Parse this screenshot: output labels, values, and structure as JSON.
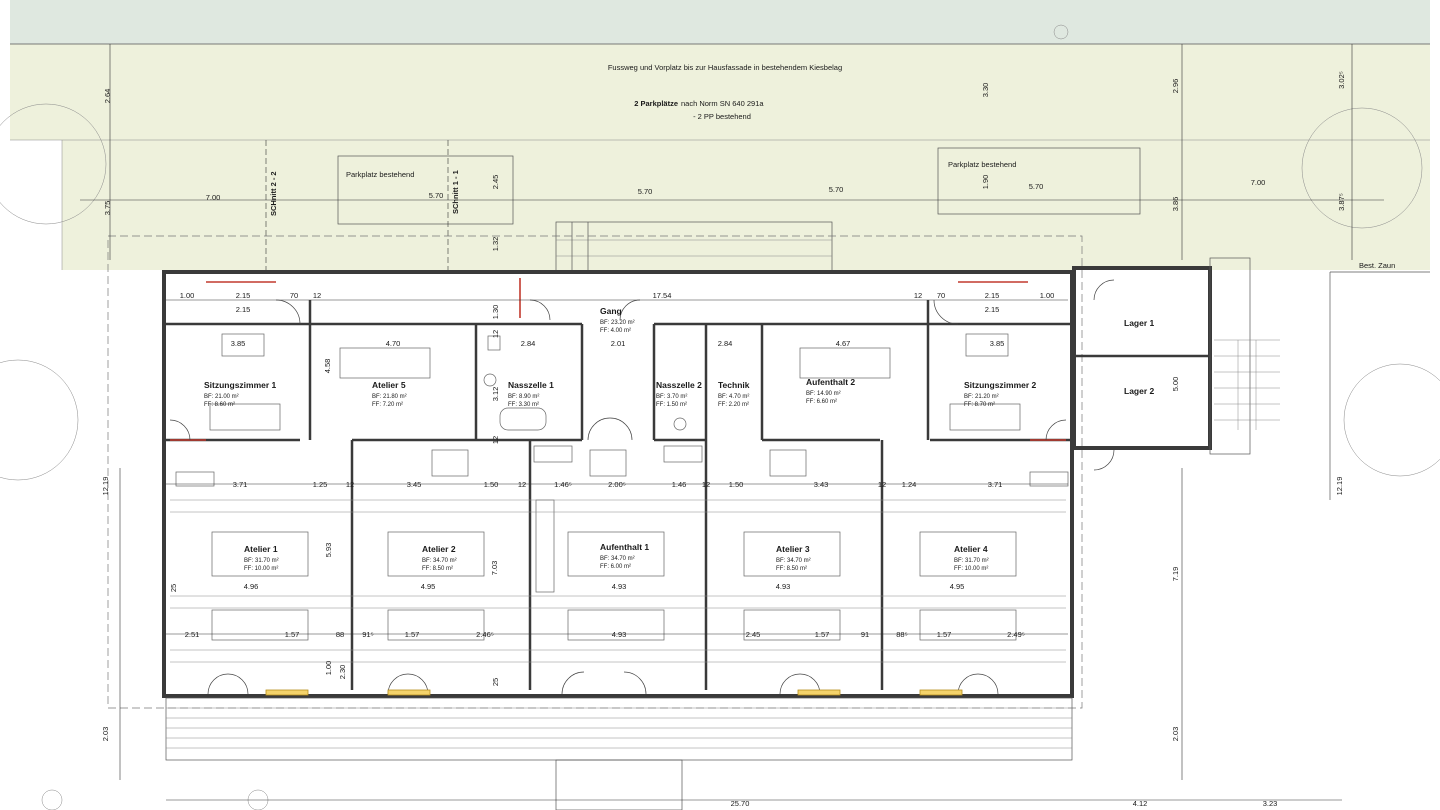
{
  "site": {
    "footpath_note": "Fussweg und Vorplatz bis zur Hausfassade in bestehendem Kiesbelag",
    "parking_title": "2 Parkplätze",
    "parking_norm": "nach Norm SN 640 291a",
    "parking_existing": "- 2 PP bestehend",
    "parking_left": "Parkplatz bestehend",
    "parking_right": "Parkplatz bestehend",
    "section_2": "SCHnitt 2 - 2",
    "section_1": "SChnitt 1 - 1",
    "fence": "Best. Zaun"
  },
  "rooms": [
    {
      "name": "Sitzungszimmer 1",
      "bf": "BF:  21.00 m²",
      "ff": "FF:  8.60 m²"
    },
    {
      "name": "Atelier 5",
      "bf": "BF:  21.80 m²",
      "ff": "FF:  7.20 m²"
    },
    {
      "name": "Nasszelle 1",
      "bf": "BF:  8.90 m²",
      "ff": "FF:  3.30 m²"
    },
    {
      "name": "Gang",
      "bf": "BF:  23.20 m²",
      "ff": "FF:  4.00 m²"
    },
    {
      "name": "Nasszelle 2",
      "bf": "BF:  3.70 m²",
      "ff": "FF:  1.50 m²"
    },
    {
      "name": "Technik",
      "bf": "BF:  4.70 m²",
      "ff": "FF:  2.20 m²"
    },
    {
      "name": "Aufenthalt 2",
      "bf": "BF:  14.90 m²",
      "ff": "FF:  6.60 m²"
    },
    {
      "name": "Sitzungszimmer 2",
      "bf": "BF:  21.20 m²",
      "ff": "FF:  8.70 m²"
    },
    {
      "name": "Lager 1",
      "bf": "",
      "ff": ""
    },
    {
      "name": "Lager 2",
      "bf": "",
      "ff": ""
    },
    {
      "name": "Atelier 1",
      "bf": "BF:  31.70 m²",
      "ff": "FF:  10.00 m²"
    },
    {
      "name": "Atelier 2",
      "bf": "BF:  34.70 m²",
      "ff": "FF:  8.50 m²"
    },
    {
      "name": "Aufenthalt 1",
      "bf": "BF:  34.70 m²",
      "ff": "FF:  6.00 m²"
    },
    {
      "name": "Atelier 3",
      "bf": "BF:  34.70 m²",
      "ff": "FF:  8.50 m²"
    },
    {
      "name": "Atelier 4",
      "bf": "BF:  31.70 m²",
      "ff": "FF:  10.00 m²"
    }
  ],
  "dimensions": {
    "site_left": [
      "2.64",
      "3.75"
    ],
    "site_right": [
      "3.30",
      "2.96",
      "3.02⁵",
      "3.86",
      "3.87⁵"
    ],
    "parking_row": [
      "7.00",
      "5.70",
      "5.70",
      "5.70",
      "5.70",
      "7.00"
    ],
    "site_mid": [
      "2.45",
      "1.90",
      "1.32"
    ],
    "top_row": [
      "1.00",
      "2.15",
      "70",
      "12",
      "17.54",
      "12",
      "70",
      "2.15",
      "1.00"
    ],
    "top_row_2": [
      "2.15",
      "2.15"
    ],
    "row_a": [
      "3.85",
      "4.70",
      "2.84",
      "2.01",
      "2.84",
      "4.67",
      "3.85"
    ],
    "row_b_vertical": [
      "4.58",
      "1.30",
      "12",
      "3.12",
      "12"
    ],
    "row_c": [
      "3.71",
      "1.25",
      "12",
      "3.45",
      "1.50",
      "12",
      "1.46⁵",
      "2.00⁵",
      "1.46",
      "12",
      "1.50",
      "3.43",
      "12",
      "1.24",
      "3.71"
    ],
    "row_d_vertical": [
      "12.19",
      "5.93",
      "7.03",
      "12.19",
      "7.19",
      "5.00"
    ],
    "row_e": [
      "4.96",
      "4.95",
      "4.93",
      "4.93",
      "4.95"
    ],
    "row_f": [
      "2.51",
      "1.57",
      "88",
      "91⁵",
      "1.57",
      "2.46⁵",
      "4.93",
      "2.45",
      "1.57",
      "91",
      "88⁵",
      "1.57",
      "2.49⁵"
    ],
    "row_g_vertical": [
      "1.00",
      "2.30",
      "25",
      "25",
      "2.03",
      "2.03"
    ],
    "bottom": [
      "25.70",
      "4.12",
      "3.23"
    ]
  }
}
